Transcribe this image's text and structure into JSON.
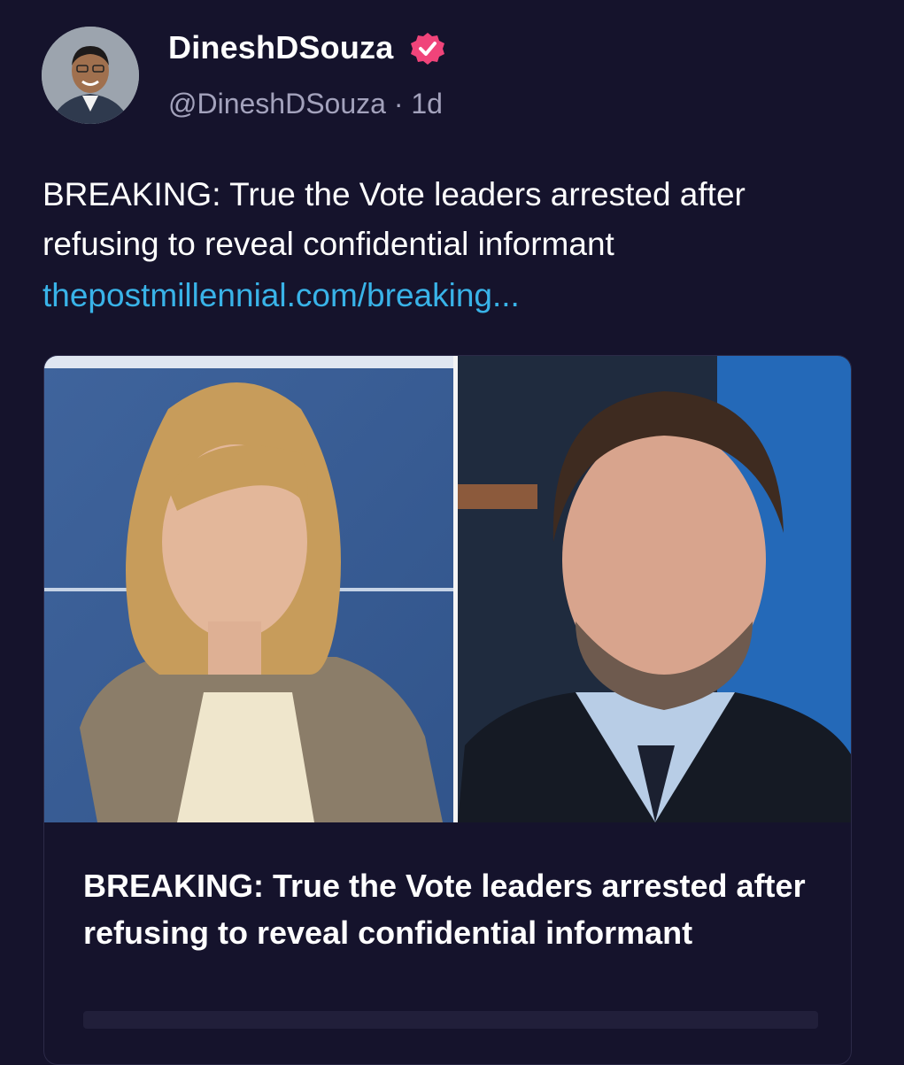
{
  "post": {
    "display_name": "DineshDSouza",
    "handle": "@DineshDSouza",
    "separator": "·",
    "timestamp": "1d",
    "verified_icon": "verified-badge-icon",
    "text": "BREAKING: True the Vote leaders arrested after refusing to reveal confidential informant",
    "link": "thepostmillennial.com/breaking..."
  },
  "card": {
    "title": "BREAKING: True the Vote leaders arrested after refusing to reveal confidential informant"
  },
  "colors": {
    "background": "#15132c",
    "link": "#39b3e8",
    "verified": "#f0447a",
    "secondary_text": "#a3a2bc"
  }
}
